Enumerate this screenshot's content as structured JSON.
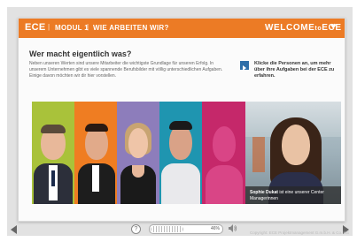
{
  "header": {
    "logo": "ECE",
    "module": "MODUL 1",
    "section": "WIE ARBEITEN WIR?",
    "welcome_a": "WELCOME",
    "welcome_to": "to",
    "welcome_b": "ECE",
    "colors": {
      "header": "#ec7b25"
    }
  },
  "main": {
    "title": "Wer macht eigentlich was?",
    "intro": "Neben unseren Werten sind unsere Mitarbeiter die wichtigste Grundlage für unseren Erfolg. In unserem Unternehmen gibt es viele spannende Berufsbilder mit völlig unterschiedlichen Aufgaben. Einige davon möchten wir dir hier vorstellen.",
    "hint": "Klicke die Personen an, um mehr über ihre Aufgaben bei der ECE zu erfahren."
  },
  "people": [
    {
      "name": "person-1",
      "bg": "#a9c23a"
    },
    {
      "name": "person-2",
      "bg": "#ef7d22"
    },
    {
      "name": "person-3",
      "bg": "#8d7dbb"
    },
    {
      "name": "person-4",
      "bg": "#1f95b0"
    },
    {
      "name": "person-5",
      "bg": "#c5286a"
    }
  ],
  "featured": {
    "name": "Sophie Dukat",
    "caption_rest": " ist eine unserer Center",
    "caption_line2": "Managerinnen"
  },
  "footer": {
    "help": "?",
    "progress_label": "46%",
    "progress_value": 0.46,
    "copyright": "Copyright: ECE Projektmanagement G.m.b.H. & Co. KG"
  },
  "icons": [
    "heart-icon",
    "help-icon",
    "speaker-icon",
    "prev-arrow-icon",
    "next-arrow-icon",
    "info-icon"
  ]
}
